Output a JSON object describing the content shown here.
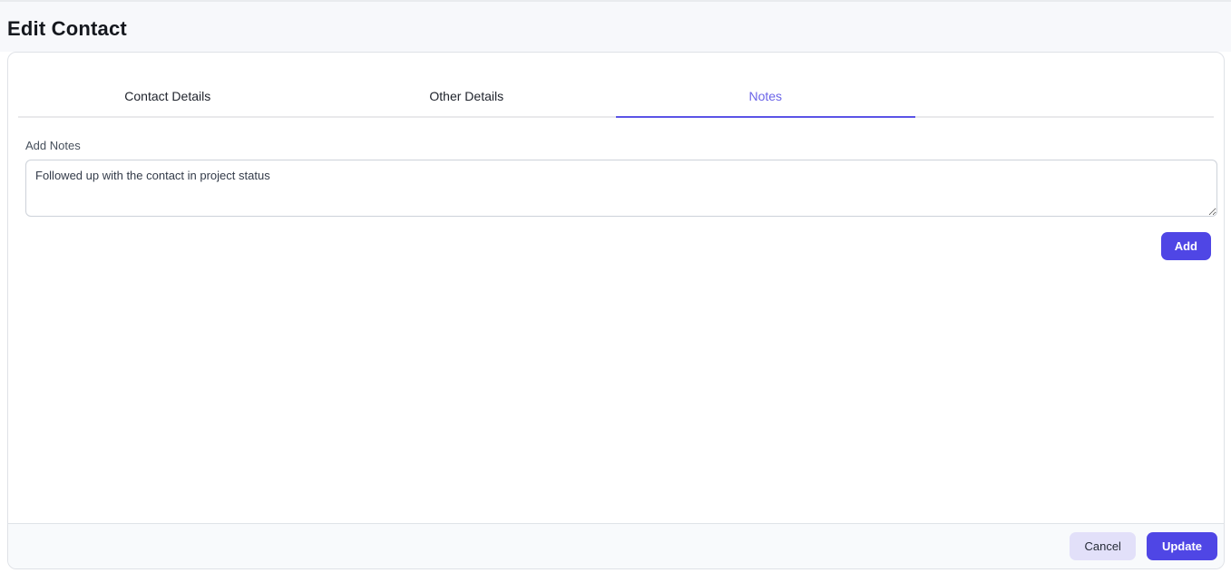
{
  "header": {
    "title": "Edit Contact"
  },
  "tabs": [
    {
      "label": "Contact Details",
      "active": false
    },
    {
      "label": "Other Details",
      "active": false
    },
    {
      "label": "Notes",
      "active": true
    }
  ],
  "notes_section": {
    "label": "Add Notes",
    "textarea_value": "Followed up with the contact in project status",
    "add_button_label": "Add"
  },
  "footer": {
    "cancel_label": "Cancel",
    "update_label": "Update"
  },
  "colors": {
    "accent": "#4f46e5",
    "active_tab_text": "#6b64e8",
    "active_tab_underline": "#5b54e6",
    "cancel_button_bg": "#e2e0f9",
    "footer_bg": "#f8fafc",
    "header_bg": "#f7f8fb",
    "card_border": "#dfe2e7"
  }
}
